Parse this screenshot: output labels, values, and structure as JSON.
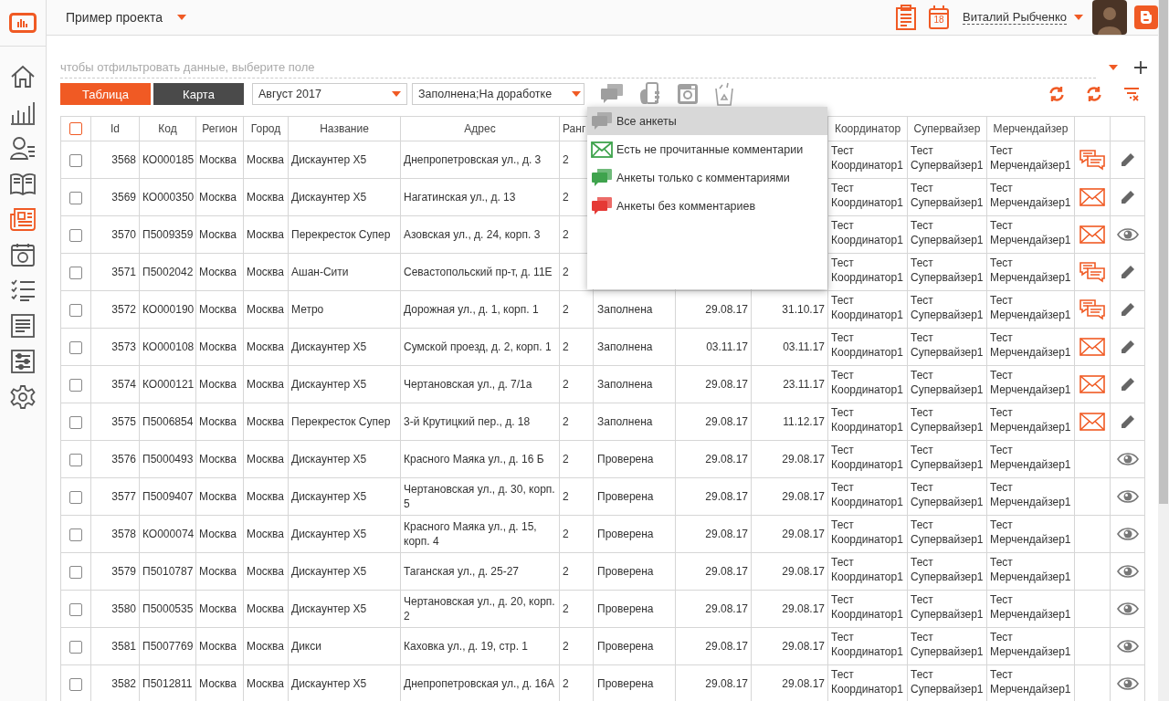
{
  "header": {
    "project": "Пример проекта",
    "calendar_day": "18",
    "user": "Виталий Рыбченко"
  },
  "sidebar": {
    "items": [
      {
        "kind": "home",
        "selected": false
      },
      {
        "kind": "bars",
        "selected": false
      },
      {
        "kind": "person-list",
        "selected": false
      },
      {
        "kind": "book",
        "selected": false
      },
      {
        "kind": "news",
        "selected": true
      },
      {
        "kind": "photo",
        "selected": false
      },
      {
        "kind": "checklist",
        "selected": false
      },
      {
        "kind": "document",
        "selected": false
      },
      {
        "kind": "sliders",
        "selected": false
      },
      {
        "kind": "gear",
        "selected": false
      }
    ]
  },
  "filter": {
    "placeholder": "чтобы отфильтровать данные, выберите поле"
  },
  "view_tabs": [
    {
      "label": "Таблица",
      "selected": true
    },
    {
      "label": "Карта",
      "selected": false
    }
  ],
  "selects": [
    "Август 2017",
    "Заполнена;На доработке"
  ],
  "comment_menu": {
    "items": [
      {
        "kind": "all",
        "label": "Все анкеты",
        "selected": true
      },
      {
        "kind": "unread",
        "label": "Есть не прочитанные комментарии",
        "selected": false
      },
      {
        "kind": "with",
        "label": "Анкеты только с комментариями",
        "selected": false
      },
      {
        "kind": "without",
        "label": "Анкеты без комментариев",
        "selected": false
      }
    ]
  },
  "table": {
    "select_all_checked": false,
    "columns": {
      "id": "Id",
      "code": "Код",
      "region": "Регион",
      "city": "Город",
      "name": "Название",
      "address": "Адрес",
      "rank": "Ранг",
      "coordinator": "Координатор",
      "supervisor": "Супервайзер",
      "merchandiser": "Мерчендайзер"
    },
    "rows": [
      {
        "checked": false,
        "id": "3568",
        "code": "КО000185",
        "region": "Москва",
        "city": "Москва",
        "name": "Дискаунтер Х5",
        "address": "Днепропетровская ул., д. 3",
        "rank": "2",
        "coordinator": "Тест Координатор1",
        "supervisor": "Тест Супервайзер1",
        "merchandiser": "Тест Мерчендайзер1",
        "comments": {
          "kind": "chat"
        },
        "action": {
          "kind": "edit"
        }
      },
      {
        "checked": false,
        "id": "3569",
        "code": "КО000350",
        "region": "Москва",
        "city": "Москва",
        "name": "Дискаунтер Х5",
        "address": "Нагатинская ул., д. 13",
        "rank": "2",
        "coordinator": "Тест Координатор1",
        "supervisor": "Тест Супервайзер1",
        "merchandiser": "Тест Мерчендайзер1",
        "comments": {
          "kind": "mail"
        },
        "action": {
          "kind": "edit"
        }
      },
      {
        "checked": false,
        "id": "3570",
        "code": "П5009359",
        "region": "Москва",
        "city": "Москва",
        "name": "Перекресток Супер",
        "address": "Азовская ул., д. 24, корп. 3",
        "rank": "2",
        "coordinator": "Тест Координатор1",
        "supervisor": "Тест Супервайзер1",
        "merchandiser": "Тест Мерчендайзер1",
        "comments": {
          "kind": "mail"
        },
        "action": {
          "kind": "view"
        }
      },
      {
        "checked": false,
        "id": "3571",
        "code": "П5002042",
        "region": "Москва",
        "city": "Москва",
        "name": "Ашан-Сити",
        "address": "Севастопольский пр-т, д. 11Е",
        "rank": "2",
        "coordinator": "Тест Координатор1",
        "supervisor": "Тест Супервайзер1",
        "merchandiser": "Тест Мерчендайзер1",
        "comments": {
          "kind": "chat"
        },
        "action": {
          "kind": "edit"
        }
      },
      {
        "checked": false,
        "id": "3572",
        "code": "КО000190",
        "region": "Москва",
        "city": "Москва",
        "name": "Метро",
        "address": "Дорожная ул., д. 1, корп. 1",
        "rank": "2",
        "status": "Заполнена",
        "date_1": "29.08.17",
        "date_2": "31.10.17",
        "coordinator": "Тест Координатор1",
        "supervisor": "Тест Супервайзер1",
        "merchandiser": "Тест Мерчендайзер1",
        "comments": {
          "kind": "chat"
        },
        "action": {
          "kind": "edit"
        }
      },
      {
        "checked": false,
        "id": "3573",
        "code": "КО000108",
        "region": "Москва",
        "city": "Москва",
        "name": "Дискаунтер Х5",
        "address": "Сумской проезд, д. 2, корп. 1",
        "rank": "2",
        "status": "Заполнена",
        "date_1": "03.11.17",
        "date_2": "03.11.17",
        "coordinator": "Тест Координатор1",
        "supervisor": "Тест Супервайзер1",
        "merchandiser": "Тест Мерчендайзер1",
        "comments": {
          "kind": "mail"
        },
        "action": {
          "kind": "edit"
        }
      },
      {
        "checked": false,
        "id": "3574",
        "code": "КО000121",
        "region": "Москва",
        "city": "Москва",
        "name": "Дискаунтер Х5",
        "address": "Чертановская ул., д. 7/1а",
        "rank": "2",
        "status": "Заполнена",
        "date_1": "29.08.17",
        "date_2": "23.11.17",
        "coordinator": "Тест Координатор1",
        "supervisor": "Тест Супервайзер1",
        "merchandiser": "Тест Мерчендайзер1",
        "comments": {
          "kind": "mail"
        },
        "action": {
          "kind": "edit"
        }
      },
      {
        "checked": false,
        "id": "3575",
        "code": "П5006854",
        "region": "Москва",
        "city": "Москва",
        "name": "Перекресток Супер",
        "address": "3-й Крутицкий пер., д. 18",
        "rank": "2",
        "status": "Заполнена",
        "date_1": "29.08.17",
        "date_2": "11.12.17",
        "coordinator": "Тест Координатор1",
        "supervisor": "Тест Супервайзер1",
        "merchandiser": "Тест Мерчендайзер1",
        "comments": {
          "kind": "mail"
        },
        "action": {
          "kind": "edit"
        }
      },
      {
        "checked": false,
        "id": "3576",
        "code": "П5000493",
        "region": "Москва",
        "city": "Москва",
        "name": "Дискаунтер Х5",
        "address": "Красного Маяка ул., д. 16 Б",
        "rank": "2",
        "status": "Проверена",
        "date_1": "29.08.17",
        "date_2": "29.08.17",
        "coordinator": "Тест Координатор1",
        "supervisor": "Тест Супервайзер1",
        "merchandiser": "Тест Мерчендайзер1",
        "comments": {
          "kind": "none"
        },
        "action": {
          "kind": "view"
        }
      },
      {
        "checked": false,
        "id": "3577",
        "code": "П5009407",
        "region": "Москва",
        "city": "Москва",
        "name": "Дискаунтер Х5",
        "address": "Чертановская ул., д. 30, корп. 5",
        "rank": "2",
        "status": "Проверена",
        "date_1": "29.08.17",
        "date_2": "29.08.17",
        "coordinator": "Тест Координатор1",
        "supervisor": "Тест Супервайзер1",
        "merchandiser": "Тест Мерчендайзер1",
        "comments": {
          "kind": "none"
        },
        "action": {
          "kind": "view"
        }
      },
      {
        "checked": false,
        "id": "3578",
        "code": "КО000074",
        "region": "Москва",
        "city": "Москва",
        "name": "Дискаунтер Х5",
        "address": "Красного Маяка ул., д. 15, корп. 4",
        "rank": "2",
        "status": "Проверена",
        "date_1": "29.08.17",
        "date_2": "29.08.17",
        "coordinator": "Тест Координатор1",
        "supervisor": "Тест Супервайзер1",
        "merchandiser": "Тест Мерчендайзер1",
        "comments": {
          "kind": "none"
        },
        "action": {
          "kind": "view"
        }
      },
      {
        "checked": false,
        "id": "3579",
        "code": "П5010787",
        "region": "Москва",
        "city": "Москва",
        "name": "Дискаунтер Х5",
        "address": "Таганская ул., д. 25-27",
        "rank": "2",
        "status": "Проверена",
        "date_1": "29.08.17",
        "date_2": "29.08.17",
        "coordinator": "Тест Координатор1",
        "supervisor": "Тест Супервайзер1",
        "merchandiser": "Тест Мерчендайзер1",
        "comments": {
          "kind": "none"
        },
        "action": {
          "kind": "view"
        }
      },
      {
        "checked": false,
        "id": "3580",
        "code": "П5000535",
        "region": "Москва",
        "city": "Москва",
        "name": "Дискаунтер Х5",
        "address": "Чертановская ул., д. 20, корп. 2",
        "rank": "2",
        "status": "Проверена",
        "date_1": "29.08.17",
        "date_2": "29.08.17",
        "coordinator": "Тест Координатор1",
        "supervisor": "Тест Супервайзер1",
        "merchandiser": "Тест Мерчендайзер1",
        "comments": {
          "kind": "none"
        },
        "action": {
          "kind": "view"
        }
      },
      {
        "checked": false,
        "id": "3581",
        "code": "П5007769",
        "region": "Москва",
        "city": "Москва",
        "name": "Дикси",
        "address": "Каховка ул., д. 19, стр. 1",
        "rank": "2",
        "status": "Проверена",
        "date_1": "29.08.17",
        "date_2": "29.08.17",
        "coordinator": "Тест Координатор1",
        "supervisor": "Тест Супервайзер1",
        "merchandiser": "Тест Мерчендайзер1",
        "comments": {
          "kind": "none"
        },
        "action": {
          "kind": "view"
        }
      },
      {
        "checked": false,
        "id": "3582",
        "code": "П5012811",
        "region": "Москва",
        "city": "Москва",
        "name": "Дискаунтер Х5",
        "address": "Днепропетровская ул., д. 16А",
        "rank": "2",
        "status": "Проверена",
        "date_1": "29.08.17",
        "date_2": "29.08.17",
        "coordinator": "Тест Координатор1",
        "supervisor": "Тест Супервайзер1",
        "merchandiser": "Тест Мерчендайзер1",
        "comments": {
          "kind": "none"
        },
        "action": {
          "kind": "view"
        }
      }
    ]
  }
}
